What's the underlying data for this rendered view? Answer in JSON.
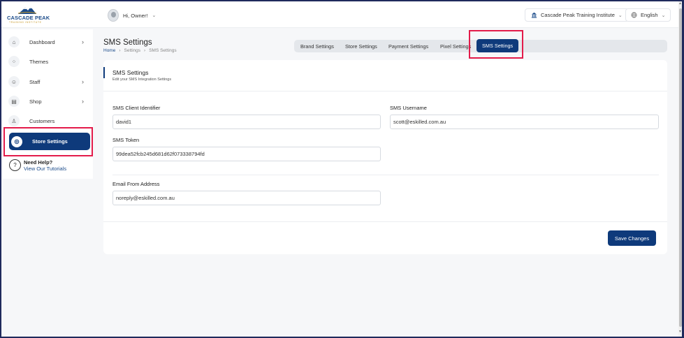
{
  "brand": {
    "name": "CASCADE PEAK",
    "tagline": "TRAINING INSTITUTE"
  },
  "header": {
    "greeting": "Hi, Owner!",
    "institute": "Cascade Peak Training Institute",
    "language": "English"
  },
  "sidebar": {
    "items": [
      {
        "label": "Dashboard",
        "icon": "home-icon",
        "has_submenu": true
      },
      {
        "label": "Themes",
        "icon": "themes-icon",
        "has_submenu": false
      },
      {
        "label": "Staff",
        "icon": "staff-icon",
        "has_submenu": true
      },
      {
        "label": "Shop",
        "icon": "shop-icon",
        "has_submenu": true
      },
      {
        "label": "Customers",
        "icon": "customers-icon",
        "has_submenu": false
      },
      {
        "label": "Store Settings",
        "icon": "settings-icon",
        "has_submenu": false,
        "active": true
      }
    ],
    "help": {
      "title": "Need Help?",
      "link": "View Our Tutorials"
    }
  },
  "page": {
    "title": "SMS Settings",
    "breadcrumb": [
      "Home",
      "Settings",
      "SMS Settings"
    ]
  },
  "tabs": [
    {
      "label": "Brand Settings"
    },
    {
      "label": "Store Settings"
    },
    {
      "label": "Payment Settings"
    },
    {
      "label": "Pixel Settings"
    },
    {
      "label": "SMS Settings",
      "active": true
    }
  ],
  "card": {
    "title": "SMS Settings",
    "subtitle": "Edit your SMS Integration Settings",
    "fields": {
      "client_id": {
        "label": "SMS Client Identifier",
        "value": "david1"
      },
      "username": {
        "label": "SMS Username",
        "value": "scott@eskilled.com.au"
      },
      "token": {
        "label": "SMS Token",
        "value": "99dea52fcb245d681d62f073338794fd"
      },
      "email_from": {
        "label": "Email From Address",
        "value": "noreply@eskilled.com.au"
      }
    },
    "save_label": "Save Changes"
  },
  "colors": {
    "primary": "#0e3a7b",
    "highlight": "#e31b4a",
    "accent_gold": "#c89a2c"
  }
}
